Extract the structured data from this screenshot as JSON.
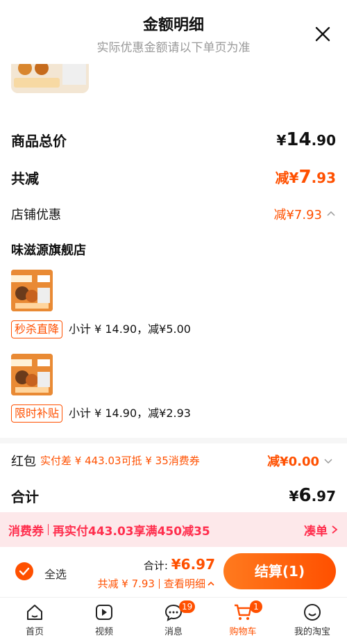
{
  "header": {
    "title": "金额明细",
    "subtitle": "实际优惠金额请以下单页为准"
  },
  "summary": {
    "goods_total_label": "商品总价",
    "goods_total_symbol": "¥",
    "goods_total_int": "14",
    "goods_total_dec": ".90",
    "total_reduce_label": "共减",
    "total_reduce_prefix": "减¥",
    "total_reduce_int": "7",
    "total_reduce_dec": ".93",
    "store_discount_label": "店铺优惠",
    "store_discount_value": "减¥7.93"
  },
  "store": {
    "name": "味滋源旗舰店",
    "items": [
      {
        "tag": "秒杀直降",
        "detail": "小计 ¥ 14.90，减¥5.00"
      },
      {
        "tag": "限时补贴",
        "detail": "小计 ¥ 14.90，减¥2.93"
      }
    ]
  },
  "hongbao": {
    "label": "红包",
    "sub": "实付差 ¥ 443.03可抵 ¥ 35消费券",
    "value": "减¥0.00"
  },
  "total": {
    "label": "合计",
    "symbol": "¥",
    "int": "6",
    "dec": ".97"
  },
  "coupon_bar": {
    "tag": "消费券",
    "text": "再实付443.03享满450减35",
    "action": "凑单"
  },
  "bottom": {
    "select_all": "全选",
    "sum_label": "合计:",
    "sum_value": "¥6.97",
    "reduce_text": "共减 ¥ 7.93",
    "detail_link": "查看明细",
    "checkout": "结算(1)"
  },
  "tabs": [
    {
      "label": "首页",
      "icon": "home-icon"
    },
    {
      "label": "视频",
      "icon": "video-icon"
    },
    {
      "label": "消息",
      "icon": "message-icon",
      "badge": "19"
    },
    {
      "label": "购物车",
      "icon": "cart-icon",
      "badge": "1",
      "active": true
    },
    {
      "label": "我的淘宝",
      "icon": "profile-icon"
    }
  ],
  "colors": {
    "accent": "#ff5000",
    "coupon": "#ff2e4d",
    "coupon_bg": "#fde8ea"
  }
}
